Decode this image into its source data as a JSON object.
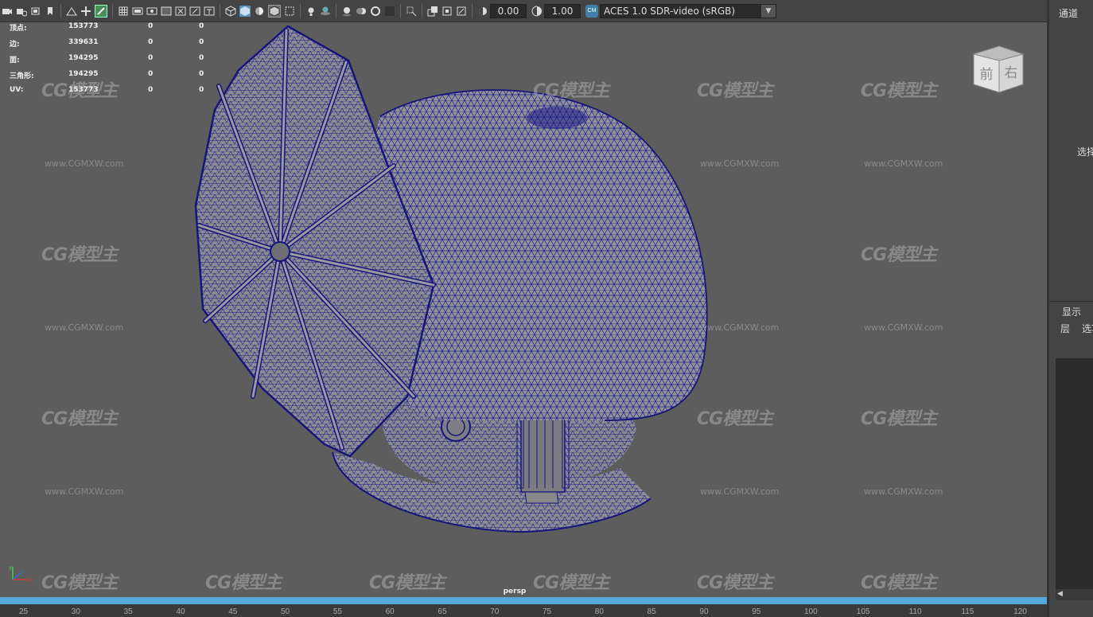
{
  "toolbar": {
    "exposure": "0.00",
    "gamma": "1.00",
    "color_space": "ACES 1.0 SDR-video (sRGB)",
    "color_mgmt_badge": "CM"
  },
  "hud": {
    "rows": [
      {
        "label": "顶点:",
        "value": "153773",
        "c1": "0",
        "c2": "0"
      },
      {
        "label": "边:",
        "value": "339631",
        "c1": "0",
        "c2": "0"
      },
      {
        "label": "面:",
        "value": "194295",
        "c1": "0",
        "c2": "0"
      },
      {
        "label": "三角形:",
        "value": "194295",
        "c1": "0",
        "c2": "0"
      },
      {
        "label": "UV:",
        "value": "153773",
        "c1": "0",
        "c2": "0"
      }
    ]
  },
  "viewcube": {
    "front": "前",
    "right": "右"
  },
  "viewport": {
    "camera": "persp"
  },
  "axis": {
    "x": "x",
    "y": "y",
    "z": "z"
  },
  "watermark": {
    "logo": "CG模型主",
    "url": "www.CGMXW.com"
  },
  "timeline": {
    "ticks": [
      "25",
      "30",
      "35",
      "40",
      "45",
      "50",
      "55",
      "60",
      "65",
      "70",
      "75",
      "80",
      "85",
      "90",
      "95",
      "100",
      "105",
      "110",
      "115",
      "120"
    ]
  },
  "panel": {
    "channel_tab": "通道",
    "select_label": "选择",
    "display_tab": "显示",
    "layer_label": "层",
    "options_label": "选项"
  },
  "colors": {
    "wire": "#1c1c8c",
    "surface": "#909096",
    "timebar": "#56a8d8",
    "viewport_bg": "#5d5d5d"
  }
}
